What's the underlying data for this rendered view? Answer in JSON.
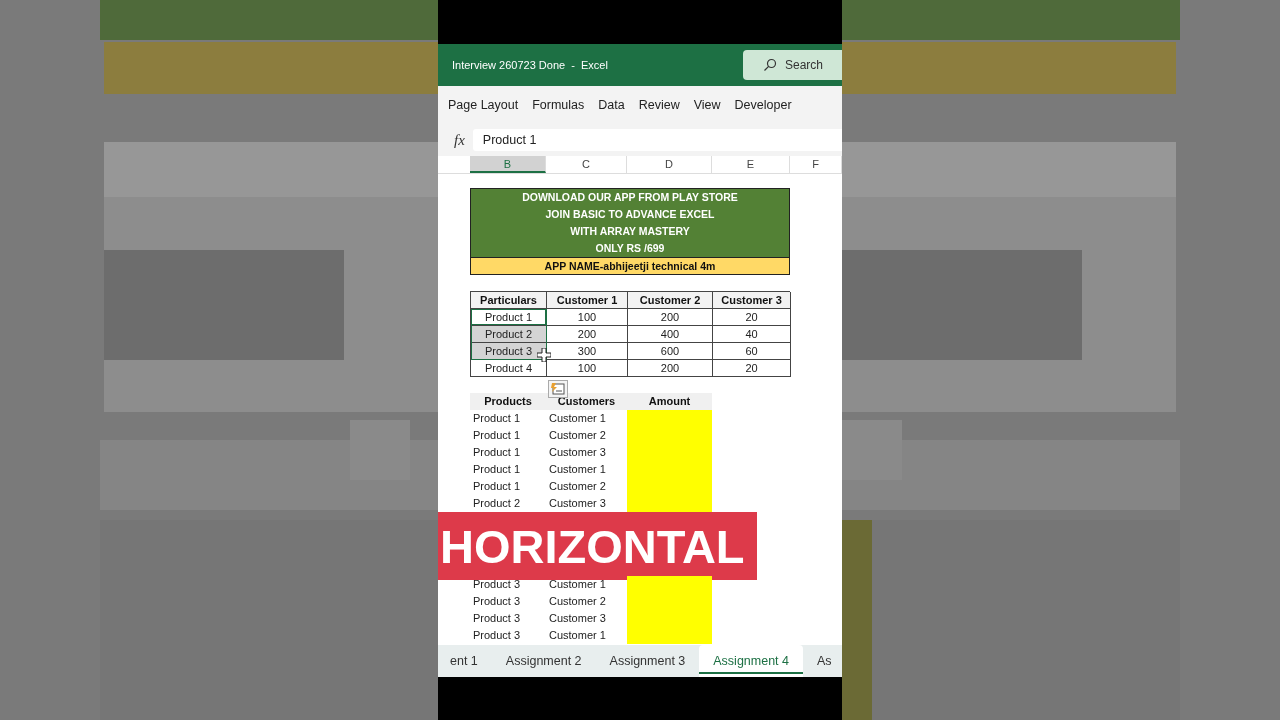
{
  "title_bar": {
    "title": "Interview 260723 Done  -  Excel",
    "search": "Search"
  },
  "ribbon_tabs": [
    "Page Layout",
    "Formulas",
    "Data",
    "Review",
    "View",
    "Developer"
  ],
  "formula_bar": {
    "fx": "fx",
    "value": "Product 1"
  },
  "column_headers": [
    {
      "label": "B",
      "selected": true
    },
    {
      "label": "C",
      "selected": false
    },
    {
      "label": "D",
      "selected": false
    },
    {
      "label": "E",
      "selected": false
    },
    {
      "label": "F",
      "selected": false
    }
  ],
  "banner": {
    "lines": [
      "DOWNLOAD OUR APP FROM PLAY STORE",
      "JOIN BASIC TO ADVANCE EXCEL",
      "WITH ARRAY MASTERY",
      "ONLY RS /699"
    ],
    "app_name": "APP NAME-abhijeetji technical 4m"
  },
  "table": {
    "columns": [
      "Particulars",
      "Customer 1",
      "Customer 2",
      "Customer 3"
    ],
    "rows": [
      {
        "cells": [
          "Product 1",
          "100",
          "200",
          "20"
        ],
        "selected": true,
        "active": true
      },
      {
        "cells": [
          "Product 2",
          "200",
          "400",
          "40"
        ],
        "selected": true,
        "active": false
      },
      {
        "cells": [
          "Product 3",
          "300",
          "600",
          "60"
        ],
        "selected": true,
        "active": false
      },
      {
        "cells": [
          "Product 4",
          "100",
          "200",
          "20"
        ],
        "selected": false,
        "active": false
      }
    ]
  },
  "list": {
    "columns": [
      "Products",
      "Customers",
      "Amount"
    ],
    "rows_top": [
      [
        "Product 1",
        "Customer 1"
      ],
      [
        "Product 1",
        "Customer 2"
      ],
      [
        "Product 1",
        "Customer 3"
      ],
      [
        "Product 1",
        "Customer 1"
      ],
      [
        "Product 1",
        "Customer 2"
      ],
      [
        "Product 2",
        "Customer 3"
      ]
    ],
    "rows_bottom": [
      [
        "Product 3",
        "Customer 1"
      ],
      [
        "Product 3",
        "Customer 2"
      ],
      [
        "Product 3",
        "Customer 3"
      ],
      [
        "Product 3",
        "Customer 1"
      ]
    ]
  },
  "caption": "HORIZONTAL",
  "sheet_tabs": [
    {
      "label": "ent 1",
      "selected": false
    },
    {
      "label": "Assignment 2",
      "selected": false
    },
    {
      "label": "Assignment 3",
      "selected": false
    },
    {
      "label": "Assignment 4",
      "selected": true
    },
    {
      "label": "As",
      "selected": false
    }
  ]
}
